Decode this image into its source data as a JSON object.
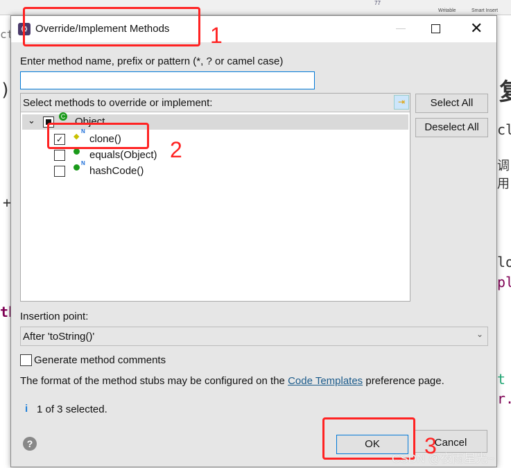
{
  "background": {
    "fragments": [
      "ct",
      ")",
      "+",
      "th",
      "复",
      "clo",
      "调用",
      "lor",
      "pl",
      "t",
      "r."
    ],
    "status": [
      "Writable",
      "Smart Insert",
      "77"
    ]
  },
  "dialog": {
    "title": "Override/Implement Methods",
    "filter_label": "Enter method name, prefix or pattern (*, ? or camel case)",
    "filter_value": "",
    "tree_label": "Select methods to override or implement:",
    "tree": {
      "parent": "Object",
      "items": [
        {
          "label": "clone()",
          "checked": true,
          "icon": "protected-method-icon"
        },
        {
          "label": "equals(Object)",
          "checked": false,
          "icon": "public-method-icon"
        },
        {
          "label": "hashCode()",
          "checked": false,
          "icon": "public-native-method-icon"
        }
      ]
    },
    "select_all": "Select All",
    "deselect_all": "Deselect All",
    "insertion_label": "Insertion point:",
    "insertion_value": "After 'toString()'",
    "generate_comments": "Generate method comments",
    "format_text_pre": "The format of the method stubs may be configured on the ",
    "format_link": "Code Templates",
    "format_text_post": " preference page.",
    "status": "1 of 3 selected.",
    "ok": "OK",
    "cancel": "Cancel"
  },
  "annotations": [
    "1",
    "2",
    "3"
  ],
  "watermark": "CSDN @夜雨星光~"
}
